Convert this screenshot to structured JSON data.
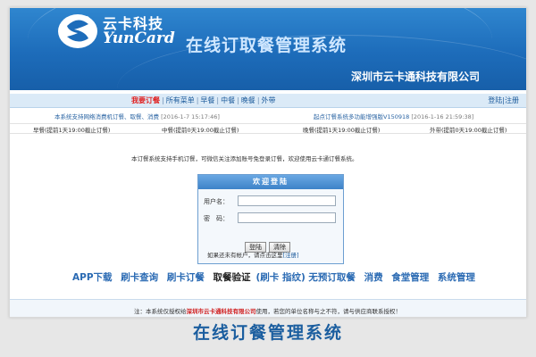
{
  "header": {
    "logo_cn": "云卡科技",
    "logo_en": "YunCard",
    "system_title": "在线订取餐管理系统",
    "company": "深圳市云卡通科技有限公司"
  },
  "nav": {
    "items": [
      "我要订餐",
      "所有菜单",
      "早餐",
      "中餐",
      "晚餐",
      "外带"
    ],
    "login": "登陆",
    "register": "注册"
  },
  "info": {
    "left_text": "本系统支持网络消费机订餐、取餐、消费",
    "left_time": "[2016-1-7 15:17:46]",
    "right_text": "起点订餐系统多功能增强版V150918",
    "right_time": "[2016-1-16 21:59:38]"
  },
  "meals": {
    "breakfast": "早餐(提前1天19:00截止订餐)",
    "lunch": "中餐(提前0天19:00截止订餐)",
    "dinner": "晚餐(提前1天19:00截止订餐)",
    "takeout": "外带(提前0天19:00截止订餐)"
  },
  "notice": "本订餐系统支持手机订餐，可微信关注添加账号免登录订餐，欢迎使用云卡通订餐系统。",
  "login": {
    "title": "欢迎登陆",
    "user_label": "用户名：",
    "pass_label": "密　码：",
    "login_btn": "登陆",
    "clear_btn": "清除",
    "hint": "如果还未有帐户，请点击这里",
    "hint_link": "[注册]"
  },
  "functions": {
    "app": "APP下载",
    "card_query": "刷卡查询",
    "card_order": "刷卡订餐",
    "verify": "取餐验证",
    "verify_sub": "(刷卡 指纹)",
    "no_order": "无预订取餐",
    "consume": "消费",
    "canteen": "食堂管理",
    "system": "系统管理"
  },
  "footer": {
    "prefix": "注：本系统仅授权给",
    "company": "深圳市云卡通科技有限公司",
    "suffix": "使用，若您的单位名称与之不符，请与供应商联系授权！"
  },
  "caption": "在线订餐管理系统",
  "colors": {
    "header_blue": "#1d6cba",
    "link_blue": "#2a6ab3",
    "active_red": "#e02020"
  }
}
